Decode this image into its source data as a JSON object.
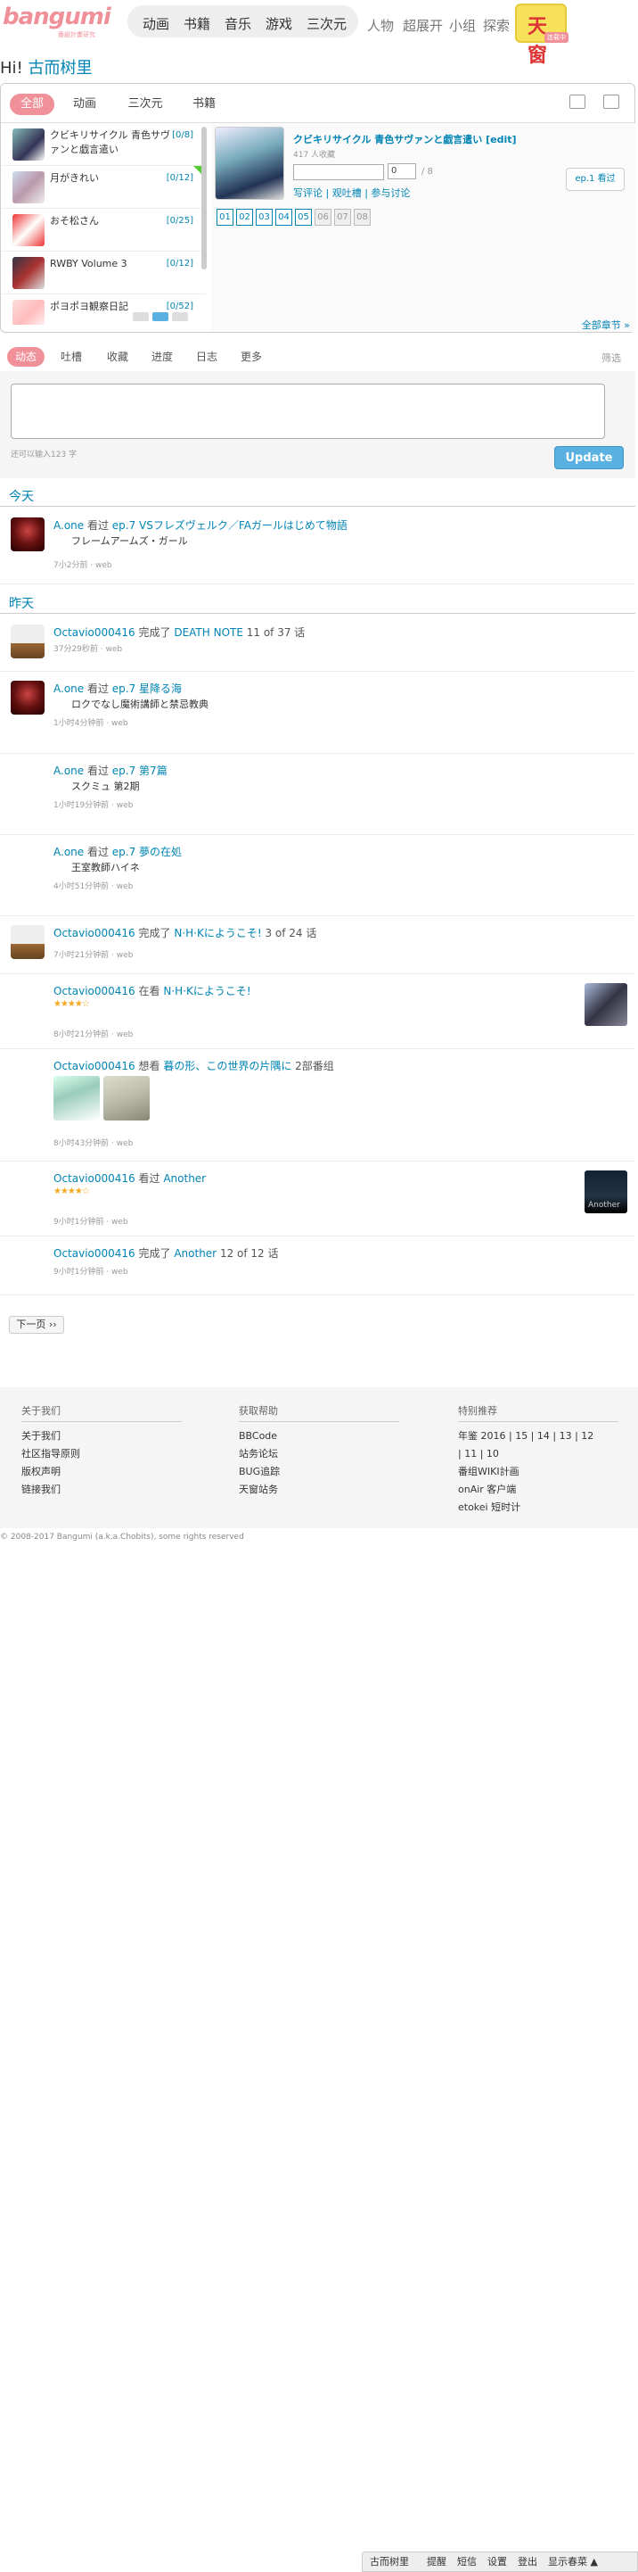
{
  "header": {
    "logo": "bangumi",
    "logo_sub": "番組計畫研究",
    "nav_main": [
      "动画",
      "书籍",
      "音乐",
      "游戏",
      "三次元"
    ],
    "nav_sec": [
      "人物",
      "超展开",
      "小组",
      "探索"
    ],
    "badge": "天窗",
    "badge_sub": "连载中"
  },
  "greeting": {
    "prefix": "Hi!",
    "user": "古而树里"
  },
  "progress_panel": {
    "tabs": [
      "全部",
      "动画",
      "三次元",
      "书籍"
    ],
    "items": [
      {
        "title": "クビキリサイクル 青色サヴァンと戯言遣い",
        "count": "[0/8]"
      },
      {
        "title": "月がきれい",
        "count": "[0/12]"
      },
      {
        "title": "おそ松さん",
        "count": "[0/25]"
      },
      {
        "title": "RWBY Volume 3",
        "count": "[0/12]"
      },
      {
        "title": "ポヨポヨ観察日記",
        "count": "[0/52]"
      }
    ],
    "selected": {
      "title": "クビキリサイクル 青色サヴァンと戯言遣い",
      "edit": "[edit]",
      "meta": "417 人收藏",
      "progress_value": 0,
      "progress_fraction": 0,
      "progress_total": "/ 8",
      "ep_button": "ep.1 看过",
      "links": "写评论 | 观吐槽 | 参与讨论",
      "episodes": [
        "01",
        "02",
        "03",
        "04",
        "05",
        "06",
        "07",
        "08"
      ],
      "episodes_aired": 5,
      "all_chapters": "全部章节 »"
    }
  },
  "feed_tabs": {
    "tabs": [
      "动态",
      "吐槽",
      "收藏",
      "进度",
      "日志",
      "更多"
    ],
    "right": "筛选"
  },
  "compose": {
    "hint": "还可以输入123 字",
    "button": "Update"
  },
  "timeline": {
    "today": "今天",
    "yesterday": "昨天",
    "items": [
      {
        "user": "A.one",
        "action": " 看过 ",
        "target": "ep.7 VSフレズヴェルク／FAガールはじめて物語",
        "sub": "フレームアームズ・ガール",
        "meta": "7小2分前 · web"
      },
      {
        "user": "Octavio000416",
        "action": " 完成了 ",
        "target": "DEATH NOTE",
        "tail": " 11 of 37 话",
        "meta": "37分29秒前 · web"
      },
      {
        "user": "A.one",
        "action": " 看过 ",
        "target": "ep.7 星降る海",
        "sub": "ロクでなし魔術講師と禁忌教典",
        "meta": "1小时4分钟前 · web"
      },
      {
        "user": "A.one",
        "action": " 看过 ",
        "target": "ep.7 第7篇",
        "sub": "スクミュ 第2期",
        "meta": "1小时19分钟前 · web"
      },
      {
        "user": "A.one",
        "action": " 看过 ",
        "target": "ep.7 夢の在処",
        "sub": "王室教師ハイネ",
        "meta": "4小时51分钟前 · web"
      },
      {
        "user": "Octavio000416",
        "action": " 完成了 ",
        "target": "N·H·Kにようこそ!",
        "tail": " 3 of 24 话",
        "meta": "7小时21分钟前 · web"
      },
      {
        "user": "Octavio000416",
        "action": " 在看 ",
        "target": "N·H·Kにようこそ!",
        "stars": "★★★★☆",
        "meta": "8小时21分钟前 · web"
      },
      {
        "user": "Octavio000416",
        "action": " 想看 ",
        "target": "暮の形、この世界の片隅に",
        "tail": " 2部番组",
        "meta": "8小时43分钟前 · web"
      },
      {
        "user": "Octavio000416",
        "action": " 看过 ",
        "target": "Another",
        "stars": "★★★★☆",
        "thumb_text": "Another",
        "meta": "9小时1分钟前 · web"
      },
      {
        "user": "Octavio000416",
        "action": " 完成了 ",
        "target": "Another",
        "tail": " 12 of 12 话",
        "meta": "9小时1分钟前 · web"
      }
    ],
    "next": "下一页 ››"
  },
  "footer": {
    "col1": {
      "head": "关于我们",
      "items": [
        "关于我们",
        "社区指导原则",
        "版权声明",
        "链接我们"
      ]
    },
    "col2": {
      "head": "获取帮助",
      "items": [
        "BBCode",
        "站务论坛",
        "BUG追踪",
        "天窗站务"
      ]
    },
    "col3": {
      "head": "特别推荐",
      "items": [
        "年鉴 2016 | 15 | 14 | 13 | 12",
        " | 11 | 10",
        "番组WIKI計画",
        "onAir 客户端",
        "etokei 短时计"
      ]
    },
    "copyright": "© 2008-2017 Bangumi (a.k.a.Chobits), some rights reserved"
  },
  "bottom_bar": {
    "items": [
      "古而树里",
      "提醒",
      "短信",
      "设置",
      "登出",
      "显示春菜 ▲"
    ]
  },
  "colors": {
    "brand": "#F09199",
    "link": "#0084B4",
    "button": "#5AB0E0"
  }
}
